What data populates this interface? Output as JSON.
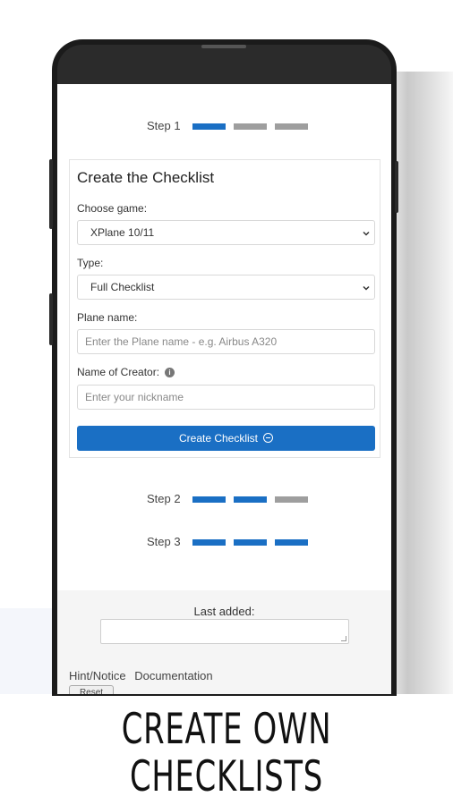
{
  "steps": [
    {
      "label": "Step 1",
      "segments": [
        true,
        false,
        false
      ]
    },
    {
      "label": "Step 2",
      "segments": [
        true,
        true,
        false
      ]
    },
    {
      "label": "Step 3",
      "segments": [
        true,
        true,
        true
      ]
    }
  ],
  "card": {
    "title": "Create the Checklist",
    "game_label": "Choose game:",
    "game_value": "XPlane 10/11",
    "type_label": "Type:",
    "type_value": "Full Checklist",
    "plane_label": "Plane name:",
    "plane_placeholder": "Enter the Plane name - e.g. Airbus A320",
    "creator_label": "Name of Creator:",
    "creator_info_icon": "i",
    "creator_placeholder": "Enter your nickname",
    "create_button": "Create Checklist"
  },
  "panel": {
    "last_added_label": "Last added:",
    "hint_link": "Hint/Notice",
    "docs_link": "Documentation",
    "small_button": "Reset"
  },
  "caption": {
    "line1": "CREATE OWN",
    "line2": "CHECKLISTS"
  },
  "colors": {
    "accent": "#1a6fc4",
    "inactive": "#9e9e9e"
  }
}
